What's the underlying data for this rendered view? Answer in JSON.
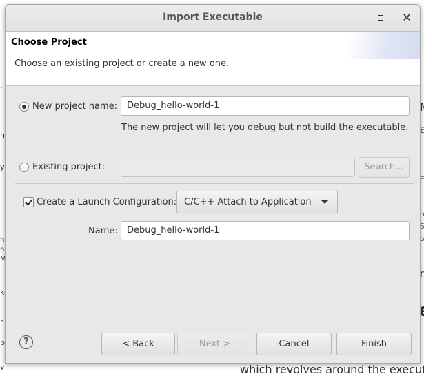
{
  "background": {
    "right_fragments": [
      "M",
      "a",
      "=",
      "S",
      "S",
      "S",
      "r",
      "e"
    ],
    "left_fragments": [
      "r",
      "n",
      "y",
      "he",
      "he",
      "Ma",
      "ke",
      "r",
      "bo",
      "x"
    ],
    "bottom_text": "which revolves around the executa"
  },
  "dialog": {
    "title": "Import Executable",
    "banner_title": "Choose Project",
    "banner_description": "Choose an existing project or create a new one.",
    "new_project": {
      "label": "New project name:",
      "value": "Debug_hello-world-1",
      "hint": "The new project will let you debug but not build the executable.",
      "selected": true
    },
    "existing_project": {
      "label": "Existing project:",
      "value": "",
      "browse_label": "Search...",
      "selected": false
    },
    "launch_config": {
      "checkbox_label": "Create a Launch Configuration:",
      "checked": true,
      "type_selected": "C/C++ Attach to Application",
      "name_label": "Name:",
      "name_value": "Debug_hello-world-1"
    },
    "buttons": {
      "back": "< Back",
      "next": "Next >",
      "cancel": "Cancel",
      "finish": "Finish"
    },
    "help_glyph": "?"
  },
  "icons": {
    "maximize": "maximize-icon",
    "close": "close-icon",
    "help": "help-icon",
    "dropdown": "chevron-down-icon"
  }
}
